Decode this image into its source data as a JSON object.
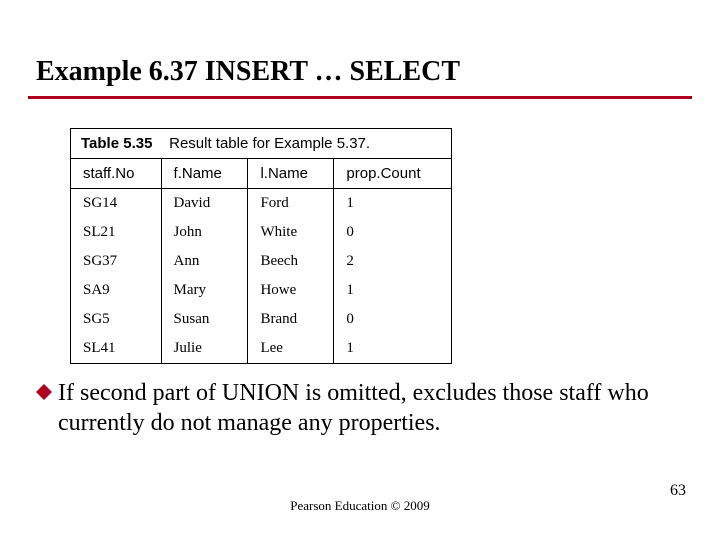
{
  "title": "Example 6.37  INSERT … SELECT",
  "table": {
    "caption_label": "Table 5.35",
    "caption_text": "Result table for Example 5.37.",
    "headers": [
      "staff.No",
      "f.Name",
      "l.Name",
      "prop.Count"
    ],
    "rows": [
      [
        "SG14",
        "David",
        "Ford",
        "1"
      ],
      [
        "SL21",
        "John",
        "White",
        "0"
      ],
      [
        "SG37",
        "Ann",
        "Beech",
        "2"
      ],
      [
        "SA9",
        "Mary",
        "Howe",
        "1"
      ],
      [
        "SG5",
        "Susan",
        "Brand",
        "0"
      ],
      [
        "SL41",
        "Julie",
        "Lee",
        "1"
      ]
    ]
  },
  "bullet": "If second part of UNION is omitted, excludes those staff who currently do not manage any properties.",
  "footer": "Pearson Education © 2009",
  "page_number": "63",
  "colors": {
    "rule": "#b00020",
    "bullet_fill": "#b00020"
  }
}
